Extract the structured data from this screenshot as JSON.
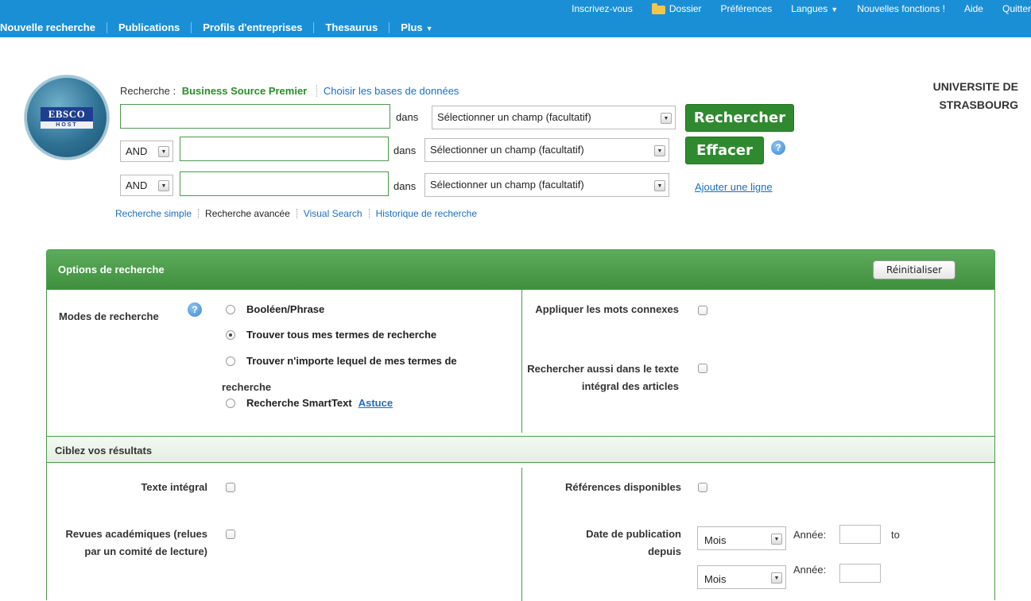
{
  "topbar": {
    "links": {
      "register": "Inscrivez-vous",
      "folder": "Dossier",
      "preferences": "Préférences",
      "languages": "Langues",
      "new_features": "Nouvelles fonctions !",
      "help": "Aide",
      "quit": "Quitter"
    },
    "nav": {
      "new_search": "Nouvelle recherche",
      "publications": "Publications",
      "company_profiles": "Profils d'entreprises",
      "thesaurus": "Thesaurus",
      "more": "Plus"
    }
  },
  "logo": {
    "brand": "EBSCO",
    "sub": "HOST"
  },
  "search": {
    "db_label": "Recherche :",
    "db_name": "Business Source Premier",
    "choose_db": "Choisir les bases de données",
    "in_label": "dans",
    "field_select": "Sélectionner un champ (facultatif)",
    "rows": [
      {
        "operator": "",
        "value": ""
      },
      {
        "operator": "AND",
        "value": ""
      },
      {
        "operator": "AND",
        "value": ""
      }
    ],
    "search_button": "Rechercher",
    "clear_button": "Effacer",
    "add_line": "Ajouter une ligne"
  },
  "subnav": {
    "simple": "Recherche simple",
    "advanced": "Recherche avancée",
    "visual": "Visual Search",
    "history": "Historique de recherche"
  },
  "institution": {
    "line1": "UNIVERSITE DE",
    "line2": "STRASBOURG"
  },
  "options": {
    "title": "Options de recherche",
    "reset": "Réinitialiser",
    "modes_label": "Modes de recherche",
    "modes": [
      {
        "label": "Booléen/Phrase",
        "selected": false
      },
      {
        "label": "Trouver tous mes termes de recherche",
        "selected": true
      },
      {
        "label": "Trouver n'importe lequel de mes termes de",
        "label_cont": "recherche",
        "selected": false
      },
      {
        "label": "Recherche SmartText",
        "selected": false
      }
    ],
    "astuce": "Astuce",
    "related_words": "Appliquer les mots connexes",
    "fulltext_search": "Rechercher aussi dans le texte intégral des articles"
  },
  "refine": {
    "title": "Ciblez vos résultats",
    "fulltext": "Texte intégral",
    "academic": "Revues académiques (relues par un comité de lecture)",
    "references": "Références disponibles",
    "pubdate": "Date de publication depuis",
    "month": "Mois",
    "year_label": "Année:",
    "to": "to"
  }
}
